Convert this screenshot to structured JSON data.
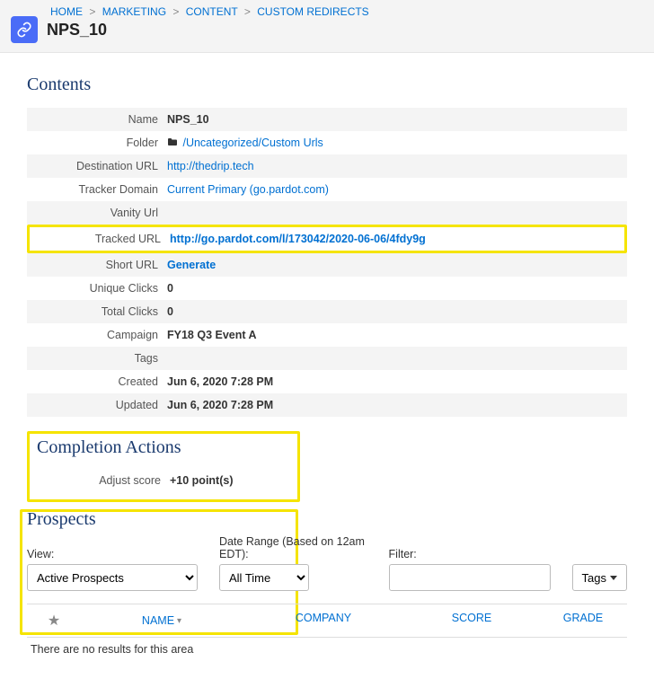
{
  "breadcrumb": {
    "items": [
      "HOME",
      "MARKETING",
      "CONTENT",
      "CUSTOM REDIRECTS"
    ]
  },
  "header": {
    "title": "NPS_10"
  },
  "contents": {
    "heading": "Contents",
    "fields": {
      "name_label": "Name",
      "name_value": "NPS_10",
      "folder_label": "Folder",
      "folder_value": "/Uncategorized/Custom Urls",
      "dest_label": "Destination URL",
      "dest_value": "http://thedrip.tech",
      "tracker_label": "Tracker Domain",
      "tracker_value": "Current Primary (go.pardot.com)",
      "vanity_label": "Vanity Url",
      "vanity_value": "",
      "tracked_label": "Tracked URL",
      "tracked_value": "http://go.pardot.com/l/173042/2020-06-06/4fdy9g",
      "short_label": "Short URL",
      "short_value": "Generate",
      "uclicks_label": "Unique Clicks",
      "uclicks_value": "0",
      "tclicks_label": "Total Clicks",
      "tclicks_value": "0",
      "campaign_label": "Campaign",
      "campaign_value": "FY18 Q3 Event A",
      "tags_label": "Tags",
      "tags_value": "",
      "created_label": "Created",
      "created_value": "Jun 6, 2020 7:28 PM",
      "updated_label": "Updated",
      "updated_value": "Jun 6, 2020 7:28 PM"
    }
  },
  "completion": {
    "heading": "Completion Actions",
    "adjust_label": "Adjust score",
    "adjust_value": "+10 point(s)"
  },
  "prospects": {
    "heading": "Prospects",
    "view_label": "View:",
    "view_value": "Active Prospects",
    "daterange_label": "Date Range (Based on 12am EDT):",
    "daterange_value": "All Time",
    "filter_label": "Filter:",
    "filter_value": "",
    "tags_btn": "Tags",
    "columns": {
      "name": "NAME",
      "company": "COMPANY",
      "score": "SCORE",
      "grade": "GRADE"
    },
    "empty": "There are no results for this area"
  }
}
